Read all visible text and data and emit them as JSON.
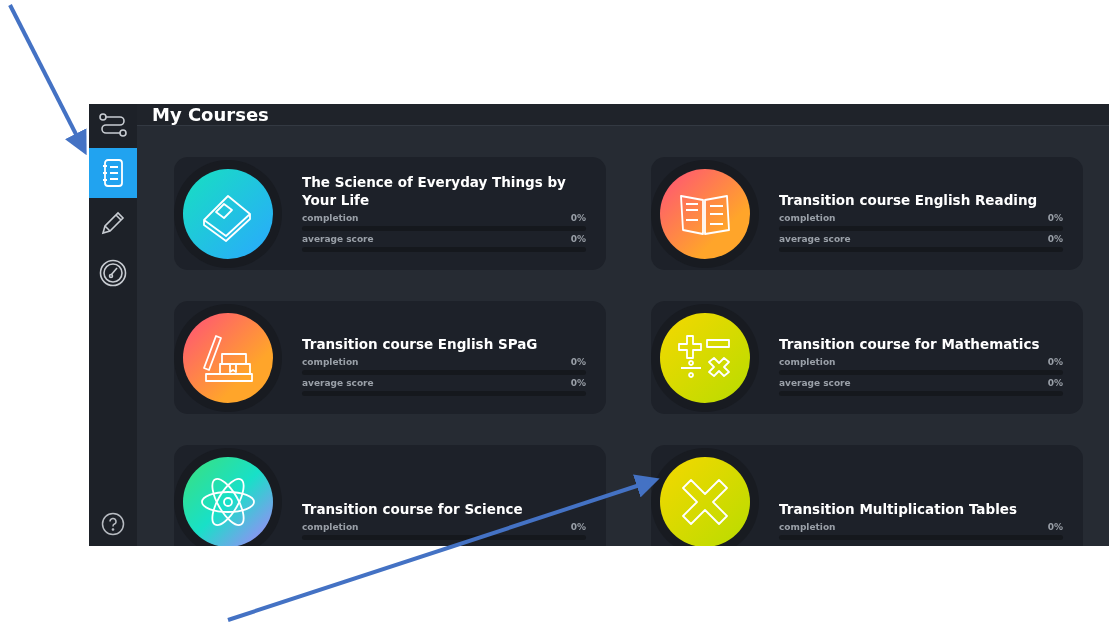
{
  "header": {
    "title": "My Courses"
  },
  "sidebar": {
    "items": [
      {
        "kind": "notebook",
        "selected": true
      },
      {
        "kind": "pencil",
        "selected": false
      },
      {
        "kind": "gauge",
        "selected": false
      }
    ]
  },
  "courses": [
    {
      "title": "The Science of Everyday Things by Your Life",
      "kind": "book",
      "metrics": [
        {
          "label": "completion",
          "value": "0%",
          "level": 0
        },
        {
          "label": "average score",
          "value": "0%",
          "level": 0
        }
      ]
    },
    {
      "title": "Transition course English Reading",
      "kind": "open-book",
      "metrics": [
        {
          "label": "completion",
          "value": "0%",
          "level": 0
        },
        {
          "label": "average score",
          "value": "0%",
          "level": 0
        }
      ]
    },
    {
      "title": "Transition course English SPaG",
      "kind": "books",
      "metrics": [
        {
          "label": "completion",
          "value": "0%",
          "level": 0
        },
        {
          "label": "average score",
          "value": "0%",
          "level": 0
        }
      ]
    },
    {
      "title": "Transition course for Mathematics",
      "kind": "math",
      "metrics": [
        {
          "label": "completion",
          "value": "0%",
          "level": 0
        },
        {
          "label": "average score",
          "value": "0%",
          "level": 0
        }
      ]
    },
    {
      "title": "Transition course for Science",
      "kind": "atom",
      "metrics": [
        {
          "label": "completion",
          "value": "0%",
          "level": 0
        }
      ]
    },
    {
      "title": "Transition Multiplication Tables",
      "kind": "times",
      "metrics": [
        {
          "label": "completion",
          "value": "0%",
          "level": 0
        }
      ]
    }
  ]
}
